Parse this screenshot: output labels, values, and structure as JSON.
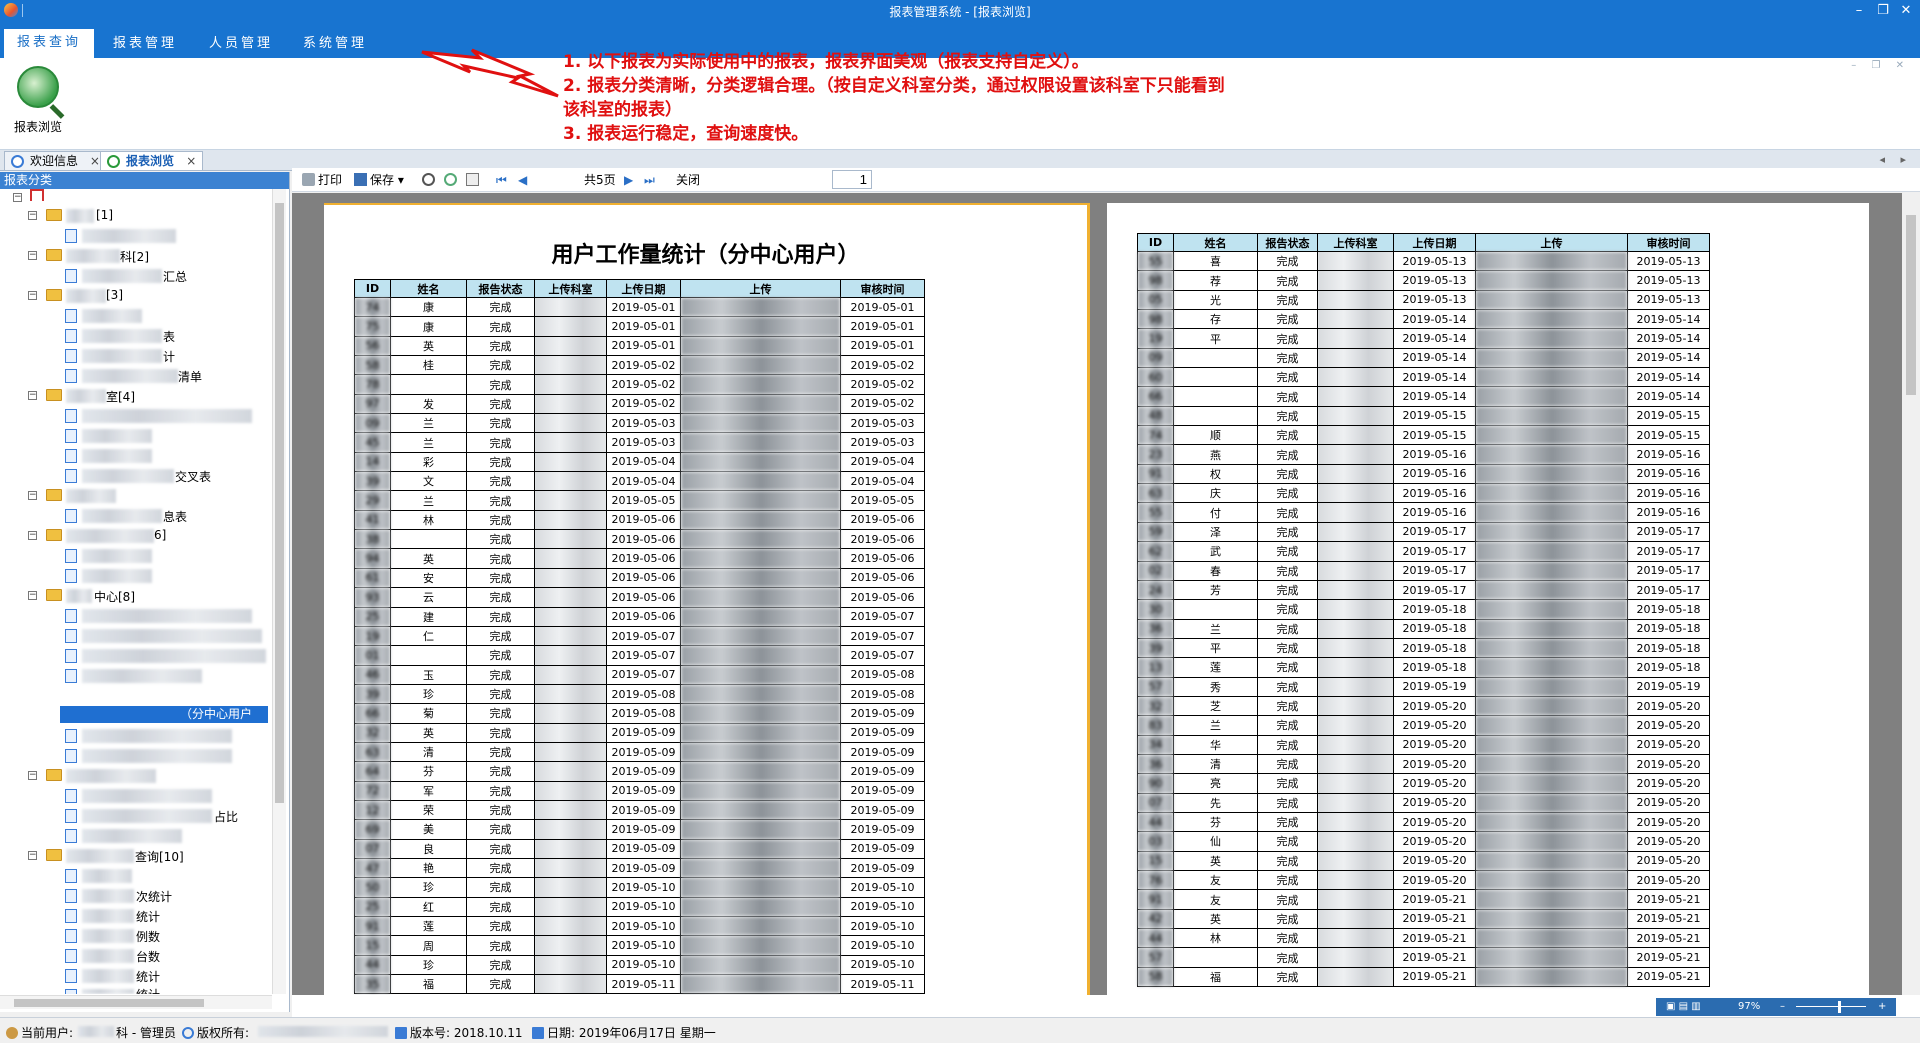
{
  "window": {
    "title": "报表管理系统 - [报表浏览]",
    "minimize": "–",
    "restore": "❐",
    "close": "✕"
  },
  "menu": [
    {
      "label": "报表查询"
    },
    {
      "label": "报表管理"
    },
    {
      "label": "人员管理"
    },
    {
      "label": "系统管理"
    }
  ],
  "ribbon": {
    "report_browse_label": "报表浏览"
  },
  "annotation": [
    "1. 以下报表为实际使用中的报表，报表界面美观（报表支持自定义）。",
    "2. 报表分类清晰，分类逻辑合理。（按自定义科室分类，通过权限设置该科室下只能看到",
    "该科室的报表）",
    "3. 报表运行稳定，查询速度快。"
  ],
  "doc_tabs": [
    {
      "label": "欢迎信息",
      "close": "×"
    },
    {
      "label": "报表浏览",
      "close": "×"
    }
  ],
  "left_panel": {
    "header": "报表分类"
  },
  "tree": {
    "labels": [
      "[1]",
      "科[2]",
      "汇总",
      "[3]",
      "表",
      "计",
      "清单",
      "室[4]",
      "交叉表",
      "息表",
      "6]",
      "中心[8]",
      "（分中心用户",
      "占比",
      "查询[10]",
      "次统计",
      "统计",
      "例数",
      "台数",
      "统计",
      "统计"
    ]
  },
  "toolbar": {
    "print": "打印",
    "save": "保存",
    "page": "1",
    "total_pages": "共5页",
    "close": "关闭"
  },
  "report1": {
    "title": "用户工作量统计（分中心用户）",
    "headers": [
      "ID",
      "姓名",
      "报告状态",
      "上传科室",
      "上传日期",
      "上传",
      "审核时间"
    ],
    "rows": [
      [
        "74",
        "康",
        "完成",
        "2019-05-01",
        "2019-05-01"
      ],
      [
        "75",
        "康",
        "完成",
        "2019-05-01",
        "2019-05-01"
      ],
      [
        "56",
        "英",
        "完成",
        "2019-05-01",
        "2019-05-01"
      ],
      [
        "58",
        "桂",
        "完成",
        "2019-05-02",
        "2019-05-02"
      ],
      [
        "78",
        "",
        "完成",
        "2019-05-02",
        "2019-05-02"
      ],
      [
        "97",
        "发",
        "完成",
        "2019-05-02",
        "2019-05-02"
      ],
      [
        "09",
        "兰",
        "完成",
        "2019-05-03",
        "2019-05-03"
      ],
      [
        "45",
        "兰",
        "完成",
        "2019-05-03",
        "2019-05-03"
      ],
      [
        "14",
        "彩",
        "完成",
        "2019-05-04",
        "2019-05-04"
      ],
      [
        "39",
        "文",
        "完成",
        "2019-05-04",
        "2019-05-04"
      ],
      [
        "29",
        "兰",
        "完成",
        "2019-05-05",
        "2019-05-05"
      ],
      [
        "41",
        "林",
        "完成",
        "2019-05-06",
        "2019-05-06"
      ],
      [
        "38",
        "",
        "完成",
        "2019-05-06",
        "2019-05-06"
      ],
      [
        "94",
        "英",
        "完成",
        "2019-05-06",
        "2019-05-06"
      ],
      [
        "61",
        "安",
        "完成",
        "2019-05-06",
        "2019-05-06"
      ],
      [
        "93",
        "云",
        "完成",
        "2019-05-06",
        "2019-05-06"
      ],
      [
        "25",
        "建",
        "完成",
        "2019-05-06",
        "2019-05-07"
      ],
      [
        "19",
        "仁",
        "完成",
        "2019-05-07",
        "2019-05-07"
      ],
      [
        "01",
        "",
        "完成",
        "2019-05-07",
        "2019-05-07"
      ],
      [
        "46",
        "玉",
        "完成",
        "2019-05-07",
        "2019-05-08"
      ],
      [
        "39",
        "珍",
        "完成",
        "2019-05-08",
        "2019-05-08"
      ],
      [
        "66",
        "菊",
        "完成",
        "2019-05-08",
        "2019-05-09"
      ],
      [
        "32",
        "英",
        "完成",
        "2019-05-09",
        "2019-05-09"
      ],
      [
        "63",
        "清",
        "完成",
        "2019-05-09",
        "2019-05-09"
      ],
      [
        "64",
        "芬",
        "完成",
        "2019-05-09",
        "2019-05-09"
      ],
      [
        "72",
        "军",
        "完成",
        "2019-05-09",
        "2019-05-09"
      ],
      [
        "12",
        "荣",
        "完成",
        "2019-05-09",
        "2019-05-09"
      ],
      [
        "69",
        "美",
        "完成",
        "2019-05-09",
        "2019-05-09"
      ],
      [
        "07",
        "良",
        "完成",
        "2019-05-09",
        "2019-05-09"
      ],
      [
        "47",
        "艳",
        "完成",
        "2019-05-09",
        "2019-05-09"
      ],
      [
        "50",
        "珍",
        "完成",
        "2019-05-10",
        "2019-05-10"
      ],
      [
        "25",
        "红",
        "完成",
        "2019-05-10",
        "2019-05-10"
      ],
      [
        "91",
        "莲",
        "完成",
        "2019-05-10",
        "2019-05-10"
      ],
      [
        "15",
        "周",
        "完成",
        "2019-05-10",
        "2019-05-10"
      ],
      [
        "44",
        "珍",
        "完成",
        "2019-05-10",
        "2019-05-10"
      ],
      [
        "35",
        "福",
        "完成",
        "2019-05-11",
        "2019-05-11"
      ]
    ]
  },
  "report2": {
    "headers": [
      "ID",
      "姓名",
      "报告状态",
      "上传科室",
      "上传日期",
      "上传",
      "审核时间"
    ],
    "rows": [
      [
        "55",
        "喜",
        "完成",
        "2019-05-13",
        "2019-05-13"
      ],
      [
        "98",
        "荐",
        "完成",
        "2019-05-13",
        "2019-05-13"
      ],
      [
        "05",
        "光",
        "完成",
        "2019-05-13",
        "2019-05-13"
      ],
      [
        "98",
        "存",
        "完成",
        "2019-05-14",
        "2019-05-14"
      ],
      [
        "19",
        "平",
        "完成",
        "2019-05-14",
        "2019-05-14"
      ],
      [
        "09",
        "",
        "完成",
        "2019-05-14",
        "2019-05-14"
      ],
      [
        "60",
        "",
        "完成",
        "2019-05-14",
        "2019-05-14"
      ],
      [
        "66",
        "",
        "完成",
        "2019-05-14",
        "2019-05-14"
      ],
      [
        "48",
        "",
        "完成",
        "2019-05-15",
        "2019-05-15"
      ],
      [
        "74",
        "顺",
        "完成",
        "2019-05-15",
        "2019-05-15"
      ],
      [
        "23",
        "燕",
        "完成",
        "2019-05-16",
        "2019-05-16"
      ],
      [
        "91",
        "权",
        "完成",
        "2019-05-16",
        "2019-05-16"
      ],
      [
        "63",
        "庆",
        "完成",
        "2019-05-16",
        "2019-05-16"
      ],
      [
        "55",
        "付",
        "完成",
        "2019-05-16",
        "2019-05-16"
      ],
      [
        "59",
        "泽",
        "完成",
        "2019-05-17",
        "2019-05-17"
      ],
      [
        "62",
        "武",
        "完成",
        "2019-05-17",
        "2019-05-17"
      ],
      [
        "02",
        "春",
        "完成",
        "2019-05-17",
        "2019-05-17"
      ],
      [
        "24",
        "芳",
        "完成",
        "2019-05-17",
        "2019-05-17"
      ],
      [
        "30",
        "",
        "完成",
        "2019-05-18",
        "2019-05-18"
      ],
      [
        "36",
        "兰",
        "完成",
        "2019-05-18",
        "2019-05-18"
      ],
      [
        "39",
        "平",
        "完成",
        "2019-05-18",
        "2019-05-18"
      ],
      [
        "13",
        "莲",
        "完成",
        "2019-05-18",
        "2019-05-18"
      ],
      [
        "57",
        "秀",
        "完成",
        "2019-05-19",
        "2019-05-19"
      ],
      [
        "32",
        "芝",
        "完成",
        "2019-05-20",
        "2019-05-20"
      ],
      [
        "83",
        "兰",
        "完成",
        "2019-05-20",
        "2019-05-20"
      ],
      [
        "34",
        "华",
        "完成",
        "2019-05-20",
        "2019-05-20"
      ],
      [
        "36",
        "清",
        "完成",
        "2019-05-20",
        "2019-05-20"
      ],
      [
        "90",
        "亮",
        "完成",
        "2019-05-20",
        "2019-05-20"
      ],
      [
        "07",
        "先",
        "完成",
        "2019-05-20",
        "2019-05-20"
      ],
      [
        "44",
        "芬",
        "完成",
        "2019-05-20",
        "2019-05-20"
      ],
      [
        "03",
        "仙",
        "完成",
        "2019-05-20",
        "2019-05-20"
      ],
      [
        "15",
        "英",
        "完成",
        "2019-05-20",
        "2019-05-20"
      ],
      [
        "76",
        "友",
        "完成",
        "2019-05-20",
        "2019-05-20"
      ],
      [
        "91",
        "友",
        "完成",
        "2019-05-21",
        "2019-05-21"
      ],
      [
        "42",
        "英",
        "完成",
        "2019-05-21",
        "2019-05-21"
      ],
      [
        "44",
        "林",
        "完成",
        "2019-05-21",
        "2019-05-21"
      ],
      [
        "57",
        "",
        "完成",
        "2019-05-21",
        "2019-05-21"
      ],
      [
        "58",
        "福",
        "完成",
        "2019-05-21",
        "2019-05-21"
      ]
    ]
  },
  "zoom": {
    "value": "97%",
    "minus": "–",
    "plus": "+"
  },
  "status": {
    "user": "当前用户:",
    "user_role": "科 - 管理员",
    "copyright": "版权所有:",
    "version": "版本号: 2018.10.11",
    "date": "日期: 2019年06月17日 星期一"
  }
}
